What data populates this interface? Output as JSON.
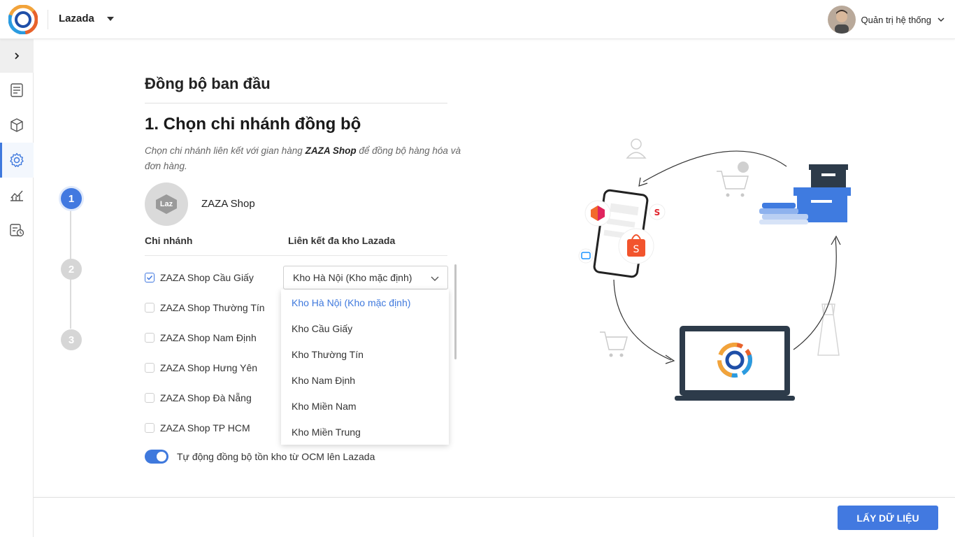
{
  "header": {
    "channel": "Lazada",
    "user_name": "Quản trị hệ thống"
  },
  "sidebar": {
    "items": [
      {
        "icon": "expand-chevron-icon"
      },
      {
        "icon": "document-icon"
      },
      {
        "icon": "box-icon"
      },
      {
        "icon": "gear-icon",
        "active": true
      },
      {
        "icon": "chart-icon"
      },
      {
        "icon": "report-clock-icon"
      }
    ]
  },
  "main": {
    "page_title": "Đồng bộ ban đầu",
    "section_title": "1. Chọn chi nhánh đồng bộ",
    "desc_before": "Chọn chi nhánh liên kết với gian hàng ",
    "desc_shop": "ZAZA Shop",
    "desc_after": " để đồng bộ hàng hóa và đơn hàng.",
    "shop_logo_text": "Laz",
    "shop_name": "ZAZA Shop",
    "col_branch": "Chi nhánh",
    "col_warehouse": "Liên kết đa kho Lazada",
    "branches": [
      {
        "label": "ZAZA Shop Cầu Giấy",
        "checked": true
      },
      {
        "label": "ZAZA Shop Thường Tín",
        "checked": false
      },
      {
        "label": "ZAZA Shop Nam Định",
        "checked": false
      },
      {
        "label": "ZAZA Shop Hưng Yên",
        "checked": false
      },
      {
        "label": "ZAZA Shop Đà Nẵng",
        "checked": false
      },
      {
        "label": "ZAZA Shop TP HCM",
        "checked": false
      }
    ],
    "select_value": "Kho Hà Nội (Kho mặc định)",
    "dropdown_options": [
      "Kho Hà Nội (Kho mặc định)",
      "Kho Cầu Giấy",
      "Kho Thường Tín",
      "Kho Nam Định",
      "Kho Miền Nam",
      "Kho Miền Trung"
    ],
    "auto_sync_label": "Tự động đồng bộ tồn kho từ OCM lên Lazada",
    "auto_sync_on": true
  },
  "stepper": {
    "steps": [
      "1",
      "2",
      "3"
    ],
    "active": 1
  },
  "footer": {
    "primary_label": "LẤY DỮ LIỆU"
  },
  "colors": {
    "accent": "#4279e0",
    "step_inactive": "#d6d6d6",
    "text": "#222222"
  }
}
